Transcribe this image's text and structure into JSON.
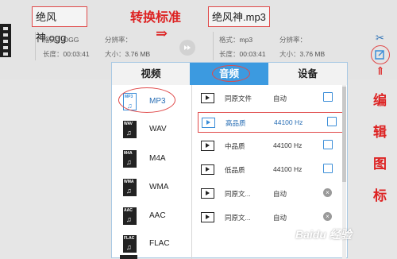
{
  "source": {
    "filename": "绝风神.ogg",
    "format_label": "格式：",
    "format": "OGG",
    "duration_label": "长度：",
    "duration": "00:03:41",
    "resolution_label": "分辨率：",
    "resolution": "",
    "size_label": "大小：",
    "size": "3.76 MB"
  },
  "target": {
    "filename": "绝风神.mp3",
    "format_label": "格式：",
    "format": "mp3",
    "duration_label": "长度：",
    "duration": "00:03:41",
    "resolution_label": "分辨率：",
    "resolution": "",
    "size_label": "大小：",
    "size": "3.76 MB"
  },
  "annotations": {
    "convert_standard": "转换标准",
    "arrow": "⇒",
    "edit_icon": [
      "编",
      "辑",
      "图",
      "标"
    ]
  },
  "tabs": [
    {
      "label": "视频",
      "active": false
    },
    {
      "label": "音频",
      "active": true
    },
    {
      "label": "设备",
      "active": false
    }
  ],
  "formats": [
    {
      "label": "MP3",
      "icon_text": "MP3",
      "selected": true
    },
    {
      "label": "WAV",
      "icon_text": "WAV",
      "selected": false
    },
    {
      "label": "M4A",
      "icon_text": "M4A",
      "selected": false
    },
    {
      "label": "WMA",
      "icon_text": "WMA",
      "selected": false
    },
    {
      "label": "AAC",
      "icon_text": "AAC",
      "selected": false
    },
    {
      "label": "FLAC",
      "icon_text": "FLAC",
      "selected": false
    }
  ],
  "qualities": [
    {
      "name": "同原文件",
      "value": "自动",
      "action": "edit"
    },
    {
      "name": "高品质",
      "value": "44100 Hz",
      "action": "edit",
      "selected": true
    },
    {
      "name": "中品质",
      "value": "44100 Hz",
      "action": "edit"
    },
    {
      "name": "低品质",
      "value": "44100 Hz",
      "action": "edit"
    },
    {
      "name": "同原文...",
      "value": "自动",
      "action": "delete"
    },
    {
      "name": "同原文...",
      "value": "自动",
      "action": "delete"
    }
  ],
  "colors": {
    "accent": "#3c9ae0",
    "annotation": "#dd2222"
  },
  "watermark": "Baidu 经验"
}
